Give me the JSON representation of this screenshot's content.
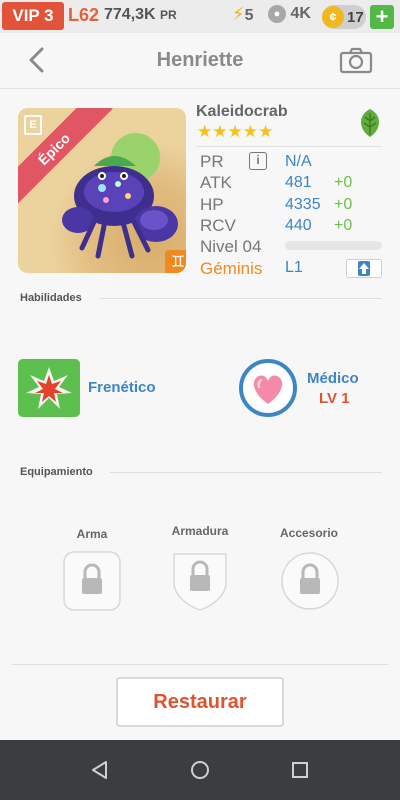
{
  "status_bar": {
    "vip": "VIP 3",
    "level": "L62",
    "pr_value": "774,3K",
    "pr_unit": "PR",
    "energy": "5",
    "food": "4K",
    "coins": "17",
    "add_label": "+"
  },
  "header": {
    "title": "Henriette",
    "back_icon": "chevron-left-icon",
    "camera_icon": "camera-icon"
  },
  "creature": {
    "rarity": "Épico",
    "rarity_badge": "E",
    "species": "Kaleidocrab",
    "stars": "★★★★★",
    "element_icon": "leaf-icon",
    "zodiac_symbol": "♊",
    "stats": {
      "pr": {
        "label": "PR",
        "value": "N/A"
      },
      "atk": {
        "label": "ATK",
        "value": "481",
        "bonus": "+0"
      },
      "hp": {
        "label": "HP",
        "value": "4335",
        "bonus": "+0"
      },
      "rcv": {
        "label": "RCV",
        "value": "440",
        "bonus": "+0"
      }
    },
    "nivel_label": "Nivel 04",
    "nivel_progress": 0,
    "zodiac_label": "Géminis",
    "zodiac_level": "L1"
  },
  "abilities": {
    "title": "Habilidades",
    "skills": [
      {
        "name": "Frenético",
        "icon": "burst-icon"
      },
      {
        "name": "Médico",
        "level": "LV 1",
        "icon": "heart-icon"
      }
    ]
  },
  "equipment": {
    "title": "Equipamiento",
    "slots": [
      {
        "label": "Arma"
      },
      {
        "label": "Armadura"
      },
      {
        "label": "Accesorio"
      }
    ]
  },
  "actions": {
    "restore": "Restaurar"
  },
  "colors": {
    "accent_blue": "#3d86c6",
    "accent_orange": "#f08a1e",
    "restore_red": "#e0532f",
    "epic_ribbon": "#e05662"
  }
}
